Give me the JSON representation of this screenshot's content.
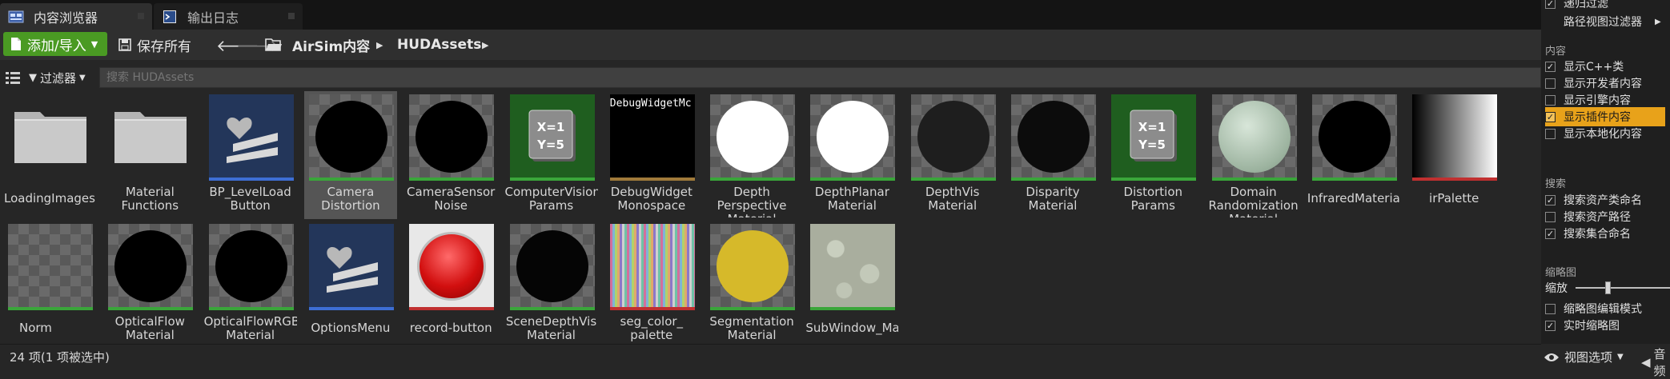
{
  "tabs": [
    {
      "label": "内容浏览器",
      "active": true
    },
    {
      "label": "输出日志",
      "active": false
    }
  ],
  "toolbar": {
    "add_label": "添加/导入",
    "save_label": "保存所有",
    "breadcrumb": [
      "AirSim内容",
      "HUDAssets"
    ]
  },
  "search": {
    "filter_label": "过滤器",
    "placeholder": "搜索 HUDAssets"
  },
  "assets": [
    {
      "label": "LoadingImages",
      "kind": "folder"
    },
    {
      "label": "Material Functions",
      "kind": "folder"
    },
    {
      "label": "BP_LevelLoad Button",
      "kind": "blueprint",
      "line": "#3d6ed4"
    },
    {
      "label": "Camera Distortion",
      "kind": "sphere",
      "fill": "#000000",
      "line": "#3aa63a",
      "selected": true
    },
    {
      "label": "CameraSensor Noise",
      "kind": "sphere",
      "fill": "#000000",
      "line": "#3aa63a"
    },
    {
      "label": "ComputerVision Params",
      "kind": "params",
      "line": "#3aa63a"
    },
    {
      "label": "DebugWidget Monospace",
      "kind": "font",
      "text": "DebugWidgetMc",
      "line": "#a07a3a"
    },
    {
      "label": "Depth Perspective Material",
      "kind": "sphere",
      "fill": "#ffffff",
      "line": "#3aa63a"
    },
    {
      "label": "DepthPlanar Material",
      "kind": "sphere",
      "fill": "#ffffff",
      "line": "#3aa63a"
    },
    {
      "label": "DepthVis Material",
      "kind": "sphere",
      "fill": "#1e1e1e",
      "line": "#3aa63a"
    },
    {
      "label": "Disparity Material",
      "kind": "sphere",
      "fill": "#0c0c0c",
      "line": "#3aa63a"
    },
    {
      "label": "Distortion Params",
      "kind": "params",
      "line": "#3aa63a"
    },
    {
      "label": "Domain Randomization Material",
      "kind": "sphere",
      "fill": "#b9ccbb",
      "line": "#3aa63a"
    },
    {
      "label": "InfraredMaterial",
      "kind": "sphere",
      "fill": "#000000",
      "line": "#3aa63a"
    },
    {
      "label": "irPalette",
      "kind": "gradient",
      "line": "#c03030"
    },
    {
      "label": "Norm",
      "kind": "partial",
      "line": "#3aa63a"
    },
    {
      "label": "OpticalFlow Material",
      "kind": "sphere",
      "fill": "#000000",
      "line": "#3aa63a"
    },
    {
      "label": "OpticalFlowRGB Material",
      "kind": "sphere",
      "fill": "#000000",
      "line": "#3aa63a"
    },
    {
      "label": "OptionsMenu",
      "kind": "blueprint",
      "line": "#3d6ed4"
    },
    {
      "label": "record-button",
      "kind": "record",
      "line": "#c03030"
    },
    {
      "label": "SceneDepthVis Material",
      "kind": "sphere",
      "fill": "#050505",
      "line": "#3aa63a"
    },
    {
      "label": "seg_color_ palette",
      "kind": "stripes",
      "line": "#c03030"
    },
    {
      "label": "Segmentation Material",
      "kind": "sphere",
      "fill": "#d6b92a",
      "line": "#3aa63a"
    },
    {
      "label": "SubWindow_Mat",
      "kind": "noise",
      "line": "#3aa63a"
    }
  ],
  "status": {
    "count_text": "24 项(1 项被选中)",
    "view_options": "视图选项"
  },
  "panel": {
    "partial_top": "递归过滤",
    "path_filter": "路径视图过滤器",
    "sections": {
      "content": "内容",
      "search": "搜索",
      "thumbnails": "缩略图"
    },
    "content_options": [
      {
        "label": "显示C++类",
        "checked": true
      },
      {
        "label": "显示开发者内容",
        "checked": false
      },
      {
        "label": "显示引擎内容",
        "checked": false
      },
      {
        "label": "显示插件内容",
        "checked": true,
        "highlighted": true
      },
      {
        "label": "显示本地化内容",
        "checked": false
      }
    ],
    "search_options": [
      {
        "label": "搜索资产类命名",
        "checked": true
      },
      {
        "label": "搜索资产路径",
        "checked": false
      },
      {
        "label": "搜索集合命名",
        "checked": true
      }
    ],
    "zoom_label": "缩放",
    "zoom_value": 0.3,
    "thumb_options": [
      {
        "label": "缩略图编辑模式",
        "checked": false
      },
      {
        "label": "实时缩略图",
        "checked": true
      }
    ],
    "audio_partial": "音频"
  }
}
